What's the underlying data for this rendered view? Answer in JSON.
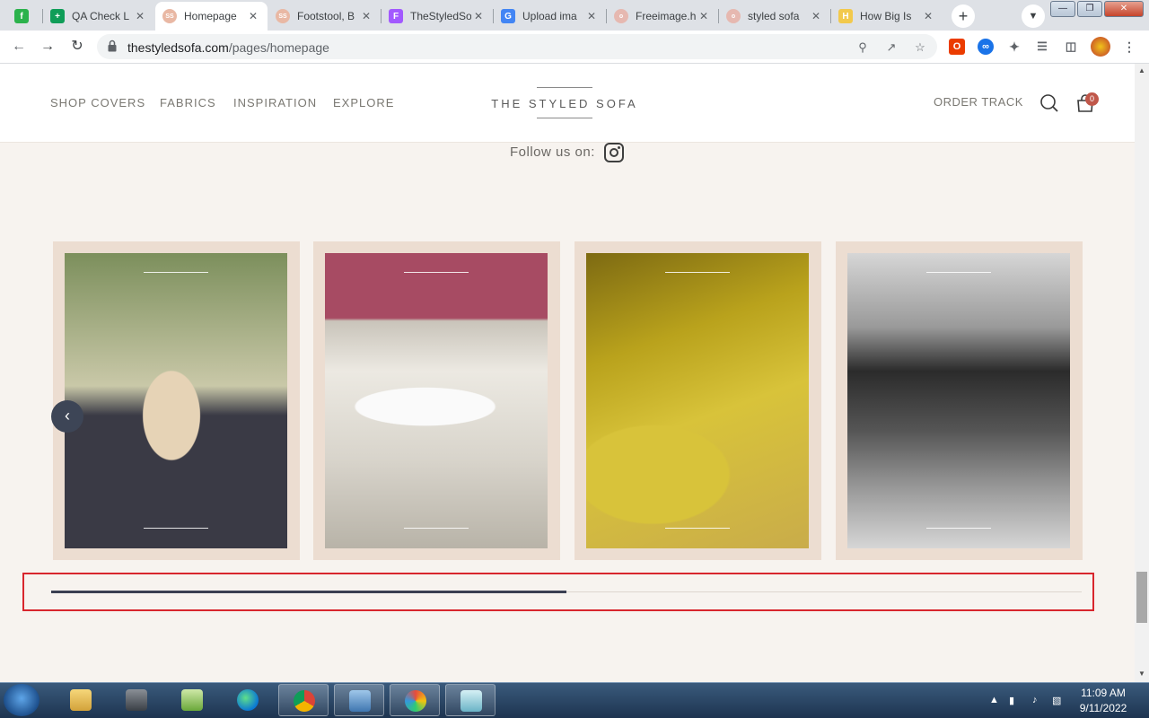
{
  "browser": {
    "tabs": [
      {
        "title": "",
        "favicon": "feedly-icon",
        "color": "#2bb24c",
        "glyph": "f",
        "active": false
      },
      {
        "title": "QA Check L",
        "favicon": "sheets-icon",
        "color": "#0f9d58",
        "glyph": "+",
        "active": false
      },
      {
        "title": "Homepage",
        "favicon": "styledsofa-icon",
        "color": "#e9b8a4",
        "glyph": "SS",
        "active": true
      },
      {
        "title": "Footstool, B",
        "favicon": "styledsofa-icon",
        "color": "#e9b8a4",
        "glyph": "SS",
        "active": false
      },
      {
        "title": "TheStyledSo",
        "favicon": "figma-icon",
        "color": "#a259ff",
        "glyph": "F",
        "active": false
      },
      {
        "title": "Upload ima",
        "favicon": "google-icon",
        "color": "#4285f4",
        "glyph": "G",
        "active": false
      },
      {
        "title": "Freeimage.h",
        "favicon": "freeimage-icon",
        "color": "#e6b8b0",
        "glyph": "o",
        "active": false
      },
      {
        "title": "styled sofa",
        "favicon": "freeimage-icon",
        "color": "#e6b8b0",
        "glyph": "o",
        "active": false
      },
      {
        "title": "How Big Is",
        "favicon": "h-icon",
        "color": "#f2c94c",
        "glyph": "H",
        "active": false
      }
    ],
    "new_tab": "+",
    "url_domain": "thestyledsofa.com",
    "url_path": "/pages/homepage"
  },
  "site": {
    "nav": [
      "SHOP COVERS",
      "FABRICS",
      "INSPIRATION",
      "EXPLORE"
    ],
    "logo": "THE STYLED SOFA",
    "order_track": "ORDER TRACK",
    "cart_count": "0",
    "follow_label": "Follow us on:",
    "slider": {
      "prev_icon": "‹",
      "progress": 0.5,
      "slides": [
        {
          "name": "slide-dog-on-sofa",
          "palette": [
            "#7c8f5c",
            "#c9c8a8",
            "#3a3a45",
            "#e6d3b6"
          ]
        },
        {
          "name": "slide-person-on-sofa",
          "palette": [
            "#c9c4ba",
            "#ece9e2",
            "#a74b63",
            "#d8d4cb"
          ]
        },
        {
          "name": "slide-yellow-velvet",
          "palette": [
            "#b9a21c",
            "#d8c33a",
            "#7d6a12",
            "#c9ac4a"
          ]
        },
        {
          "name": "slide-kids-bw",
          "palette": [
            "#555555",
            "#9a9a9a",
            "#2b2b2b",
            "#d6d6d6"
          ]
        }
      ]
    }
  },
  "taskbar": {
    "time": "11:09 AM",
    "date": "9/11/2022"
  }
}
